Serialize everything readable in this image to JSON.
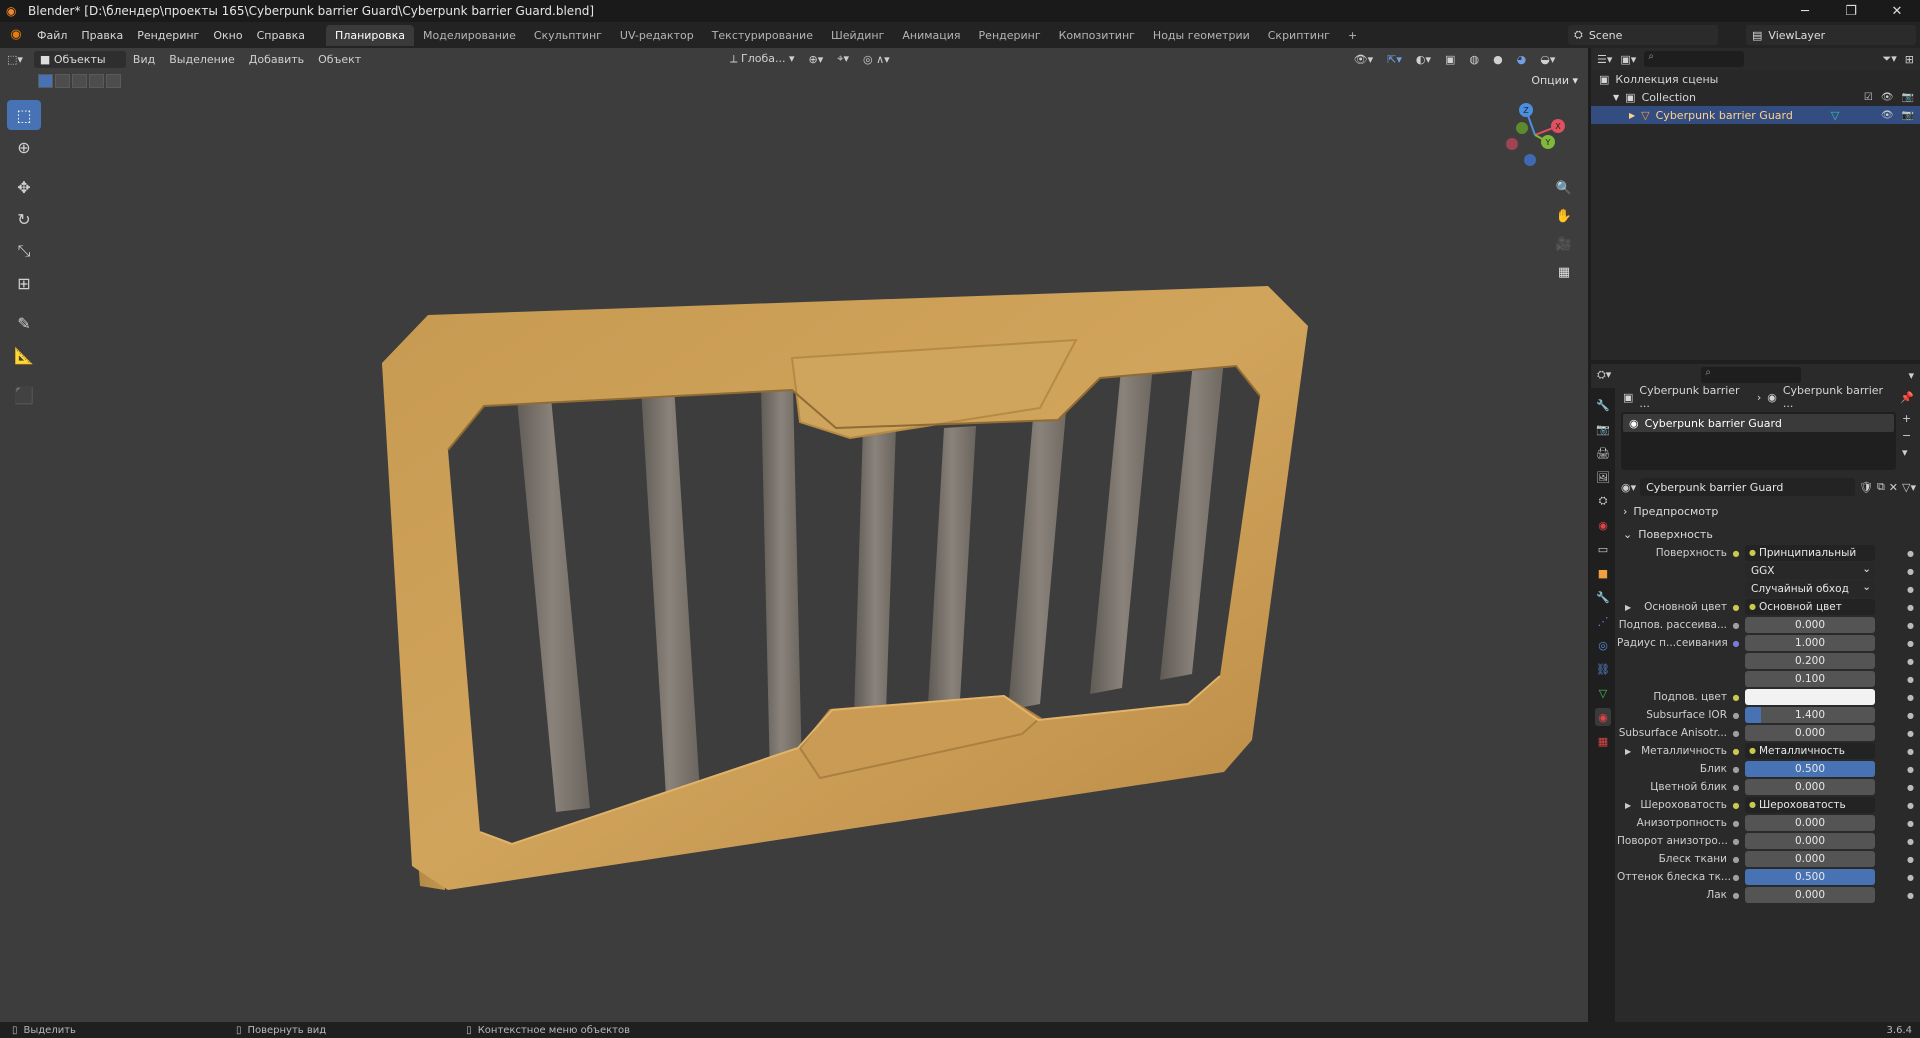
{
  "titlebar": {
    "title": "Blender* [D:\\блендер\\проекты 165\\Cyberpunk barrier Guard\\Cyberpunk barrier Guard.blend]",
    "minimize": "─",
    "restore": "❐",
    "close": "✕"
  },
  "menu": {
    "items": [
      "Файл",
      "Правка",
      "Рендеринг",
      "Окно",
      "Справка"
    ]
  },
  "workspaces": {
    "tabs": [
      "Планировка",
      "Моделирование",
      "Скульптинг",
      "UV-редактор",
      "Текстурирование",
      "Шейдинг",
      "Анимация",
      "Рендеринг",
      "Композитинг",
      "Ноды геометрии",
      "Скриптинг"
    ],
    "active": "Планировка",
    "add": "+"
  },
  "scene": {
    "name": "Scene",
    "viewlayer": "ViewLayer"
  },
  "viewport": {
    "mode": "Объекты",
    "menus": [
      "Вид",
      "Выделение",
      "Добавить",
      "Объект"
    ],
    "orientation": "Глоба...",
    "options": "Опции",
    "gizmo_axes": {
      "x": "X",
      "y": "Y",
      "z": "Z"
    }
  },
  "outliner": {
    "root": "Коллекция сцены",
    "collection": "Collection",
    "object": "Cyberpunk barrier Guard"
  },
  "properties": {
    "breadcrumb_object": "Cyberpunk barrier ...",
    "breadcrumb_material": "Cyberpunk barrier ...",
    "slot_name": "Cyberpunk barrier Guard",
    "material_name": "Cyberpunk barrier Guard",
    "sections": {
      "preview": "Предпросмотр",
      "surface": "Поверхность"
    },
    "rows": [
      {
        "label": "Поверхность",
        "value": "Принципиальный BSDF",
        "kind": "link"
      },
      {
        "label": "",
        "value": "GGX",
        "kind": "drop"
      },
      {
        "label": "",
        "value": "Случайный обход",
        "kind": "drop"
      },
      {
        "label": "Основной цвет",
        "value": "Основной цвет",
        "kind": "link",
        "expand": true
      },
      {
        "label": "Подпов. рассеива...",
        "value": "0.000",
        "kind": "num"
      },
      {
        "label": "Радиус п...сеивания",
        "value": "1.000",
        "kind": "num",
        "dot": "purple"
      },
      {
        "label": "",
        "value": "0.200",
        "kind": "num",
        "nodot": true
      },
      {
        "label": "",
        "value": "0.100",
        "kind": "num",
        "nodot": true
      },
      {
        "label": "Подпов. цвет",
        "value": "",
        "kind": "white"
      },
      {
        "label": "Subsurface IOR",
        "value": "1.400",
        "kind": "num",
        "fill": 0.12
      },
      {
        "label": "Subsurface Anisotr...",
        "value": "0.000",
        "kind": "num"
      },
      {
        "label": "Металличность",
        "value": "Металличность",
        "kind": "link",
        "expand": true
      },
      {
        "label": "Блик",
        "value": "0.500",
        "kind": "num",
        "fill": 1.0
      },
      {
        "label": "Цветной блик",
        "value": "0.000",
        "kind": "num"
      },
      {
        "label": "Шероховатость",
        "value": "Шероховатость",
        "kind": "link",
        "expand": true
      },
      {
        "label": "Анизотропность",
        "value": "0.000",
        "kind": "num"
      },
      {
        "label": "Поворот анизотро...",
        "value": "0.000",
        "kind": "num"
      },
      {
        "label": "Блеск ткани",
        "value": "0.000",
        "kind": "num"
      },
      {
        "label": "Оттенок блеска тк...",
        "value": "0.500",
        "kind": "num",
        "fill": 1.0
      },
      {
        "label": "Лак",
        "value": "0.000",
        "kind": "num"
      }
    ]
  },
  "status": {
    "select": "Выделить",
    "rotate": "Повернуть вид",
    "context": "Контекстное меню объектов",
    "version": "3.6.4"
  }
}
